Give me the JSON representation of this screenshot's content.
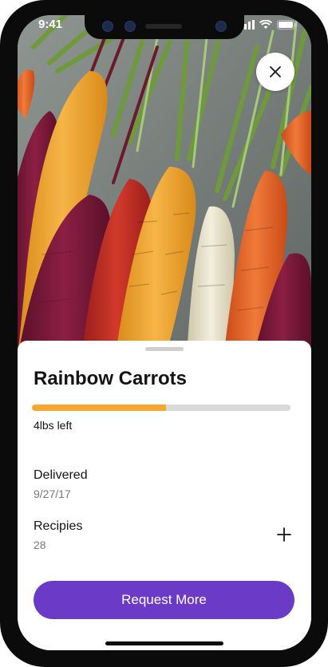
{
  "status_bar": {
    "time": "9:41"
  },
  "hero": {
    "image_subject": "rainbow carrots photo",
    "close_icon": "close-icon"
  },
  "item": {
    "title": "Rainbow Carrots",
    "remaining_fraction": 0.52,
    "remaining_label": "4lbs left",
    "progress_color": "#f8a630",
    "track_color": "#d9d9d9"
  },
  "details": {
    "delivered_label": "Delivered",
    "delivered_value": "9/27/17",
    "recipes_label": "Recipies",
    "recipes_value": "28",
    "add_icon": "plus-icon"
  },
  "actions": {
    "request_label": "Request More",
    "accent_color": "#6b3bc8"
  }
}
